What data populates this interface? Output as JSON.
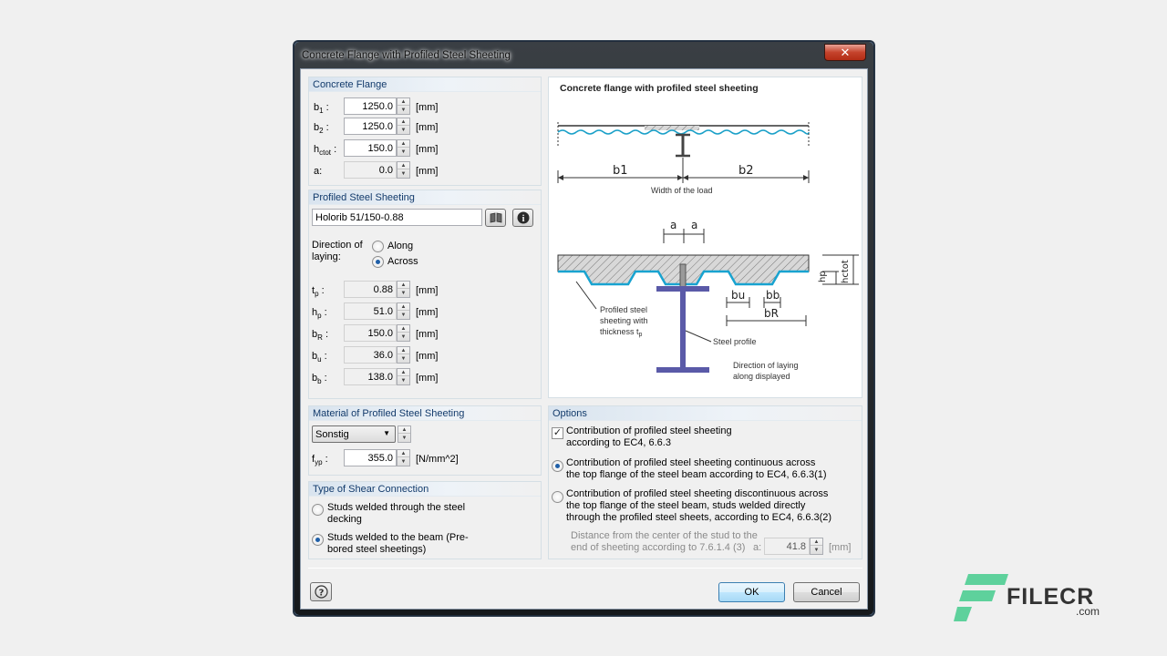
{
  "window": {
    "title": "Concrete Flange with Profiled Steel Sheeting",
    "close_label": "✕"
  },
  "concrete_flange": {
    "header": "Concrete Flange",
    "fields": [
      {
        "label": "b1 :",
        "value": "1250.0",
        "unit": "[mm]"
      },
      {
        "label": "b2 :",
        "value": "1250.0",
        "unit": "[mm]"
      },
      {
        "label": "hctot :",
        "value": "150.0",
        "unit": "[mm]"
      },
      {
        "label": "a:",
        "value": "0.0",
        "unit": "[mm]"
      }
    ]
  },
  "profiled_sheeting": {
    "header": "Profiled Steel Sheeting",
    "product": "Holorib 51/150-0.88",
    "direction_label": "Direction of laying:",
    "direction_along": "Along",
    "direction_across": "Across",
    "direction_selected": "Across",
    "fields": [
      {
        "label": "tp :",
        "value": "0.88",
        "unit": "[mm]"
      },
      {
        "label": "hp :",
        "value": "51.0",
        "unit": "[mm]"
      },
      {
        "label": "bR :",
        "value": "150.0",
        "unit": "[mm]"
      },
      {
        "label": "bu :",
        "value": "36.0",
        "unit": "[mm]"
      },
      {
        "label": "bb :",
        "value": "138.0",
        "unit": "[mm]"
      }
    ]
  },
  "material": {
    "header": "Material of Profiled Steel Sheeting",
    "selected": "Sonstig",
    "fyp_label": "fyp :",
    "fyp_value": "355.0",
    "fyp_unit": "[N/mm^2]"
  },
  "shear": {
    "header": "Type of Shear Connection",
    "opt1": "Studs welded through the steel decking",
    "opt2": "Studs welded to the beam (Pre-bored steel sheetings)",
    "selected": 2
  },
  "diagram": {
    "title": "Concrete flange with profiled steel sheeting",
    "b1": "b1",
    "b2": "b2",
    "width_caption": "Width of the load",
    "a1": "a",
    "a2": "a",
    "bu": "bu",
    "bb": "bb",
    "bR": "bR",
    "hp": "hp",
    "hctot": "hctot",
    "sheeting_note": "Profiled steel sheeting with thickness tp",
    "steel_profile": "Steel profile",
    "direction_note": "Direction of laying along displayed"
  },
  "options": {
    "header": "Options",
    "check1": "Contribution of profiled steel sheeting according to EC4, 6.6.3",
    "check1_checked": true,
    "radio1": "Contribution of profiled steel sheeting continuous across the top flange of the steel beam according to EC4, 6.6.3(1)",
    "radio2": "Contribution of profiled steel sheeting discontinuous across the top flange of the steel beam, studs welded directly through the profiled steel sheets, according to EC4, 6.6.3(2)",
    "selected": 1,
    "distance_label": "Distance from the center of the stud to the end of sheeting according to 7.6.1.4 (3)",
    "distance_a": "a:",
    "distance_value": "41.8",
    "distance_unit": "[mm]"
  },
  "buttons": {
    "ok": "OK",
    "cancel": "Cancel",
    "help": "?"
  },
  "watermark": {
    "text": "FILECR",
    "suffix": ".com"
  }
}
